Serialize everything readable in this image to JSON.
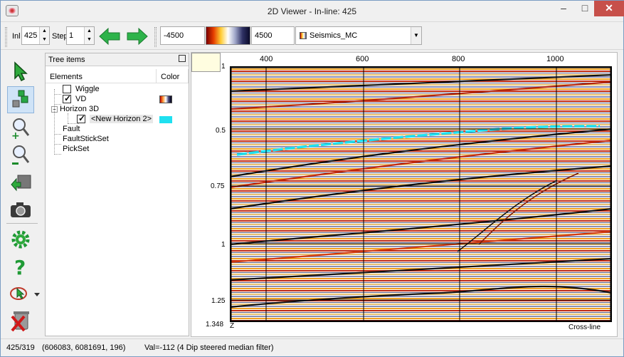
{
  "window": {
    "title": "2D Viewer - In-line: 425"
  },
  "toolbar": {
    "inl_label": "Inl",
    "inl_value": "425",
    "step_label": "Step",
    "step_value": "1",
    "clip_min": "-4500",
    "clip_max": "4500",
    "attribute": "Seismics_MC"
  },
  "tools": [
    {
      "icon": "pointer-arrow-icon"
    },
    {
      "icon": "view-cubes-icon"
    },
    {
      "icon": "zoom-in-icon"
    },
    {
      "icon": "zoom-out-icon"
    },
    {
      "icon": "flip-icon"
    },
    {
      "icon": "camera-icon"
    },
    {
      "icon": "settings-gear-icon"
    },
    {
      "icon": "help-icon"
    },
    {
      "icon": "draw-icon"
    },
    {
      "icon": "delete-bin-icon"
    }
  ],
  "tree": {
    "title": "Tree items",
    "col_elements": "Elements",
    "col_color": "Color",
    "items": {
      "wiggle": "Wiggle",
      "vd": "VD",
      "horizon3d": "Horizon 3D",
      "new_horizon": "<New Horizon 2>",
      "fault": "Fault",
      "faultstickset": "FaultStickSet",
      "pickset": "PickSet"
    },
    "horizon_color": "#1fe0f0"
  },
  "viewer": {
    "x_ticks": [
      "400",
      "600",
      "800",
      "1000"
    ],
    "y_ticks": [
      "1",
      "0.5",
      "0.75",
      "1",
      "1.25",
      "1.348"
    ],
    "z_label": "Z",
    "cross_label": "Cross-line"
  },
  "status": {
    "position": "425/319",
    "coords": "(606083, 6081691, 196)",
    "value": "Val=-112 (4 Dip steered median filter)"
  }
}
